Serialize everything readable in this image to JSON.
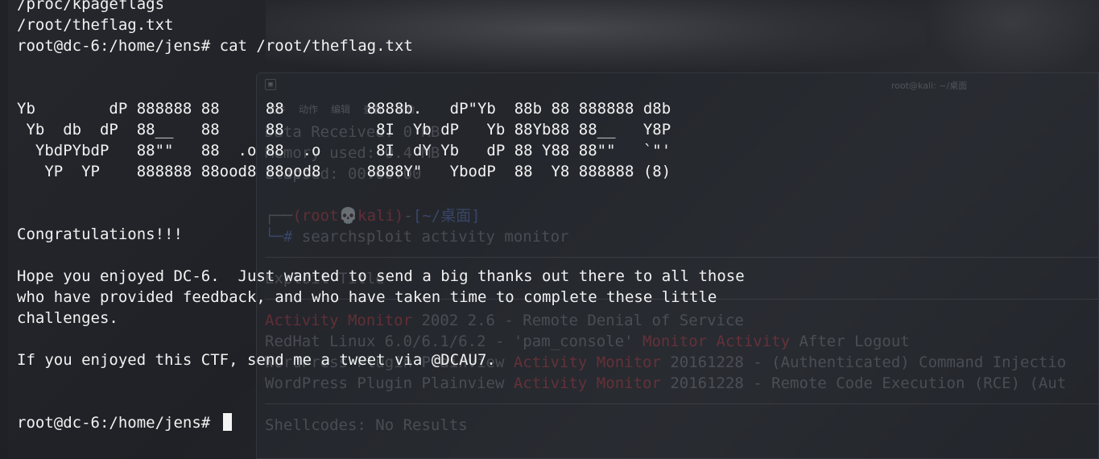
{
  "terminal": {
    "lines": [
      "/proc/kpageflags",
      "/root/theflag.txt",
      "root@dc-6:/home/jens# cat /root/theflag.txt",
      "",
      "",
      "Yb        dP 888888 88     88         8888b.   dP\"Yb  88b 88 888888 d8b",
      " Yb  db  dP  88__   88     88          8I  Yb dP   Yb 88Yb88 88__   Y8P",
      "  YbdPYbdP   88\"\"   88  .o 88  .o      8I  dY Yb   dP 88 Y88 88\"\"   `\"'",
      "   YP  YP    888888 88ood8 88ood8     8888Y\"   YbodP  88  Y8 888888 (8)",
      "",
      "",
      "Congratulations!!!",
      "",
      "Hope you enjoyed DC-6.  Just wanted to send a big thanks out there to all those",
      "who have provided feedback, and who have taken time to complete these little",
      "challenges.",
      "",
      "If you enjoyed this CTF, send me a tweet via @DCAU7.",
      "",
      "",
      "root@dc-6:/home/jens# "
    ]
  },
  "background_window": {
    "title": "root@kali: ~/桌面",
    "menu": [
      "文件",
      "动作",
      "编辑",
      "查看",
      "帮助"
    ],
    "stats": [
      "Data Received: 0 MB",
      "Memory used: 0.4 MB",
      "Elapsed: 00:00:00"
    ],
    "prompt_user": "(root💀kali)",
    "prompt_path": "[~/桌面]",
    "command": "searchsploit activity monitor",
    "header": "Exploit Title",
    "results": [
      {
        "pre": "",
        "hl": "Activity Monitor",
        "post": " 2002 2.6 - Remote Denial of Service"
      },
      {
        "pre": "RedHat Linux 6.0/6.1/6.2 - 'pam_console' ",
        "hl": "Monitor Activity",
        "post": " After Logout"
      },
      {
        "pre": "WordPress Plugin Plainview ",
        "hl": "Activity Monitor",
        "post": " 20161228 - (Authenticated) Command Injectio"
      },
      {
        "pre": "WordPress Plugin Plainview ",
        "hl": "Activity Monitor",
        "post": " 20161228 - Remote Code Execution (RCE) (Aut"
      }
    ],
    "shellcodes": "Shellcodes: No Results"
  }
}
